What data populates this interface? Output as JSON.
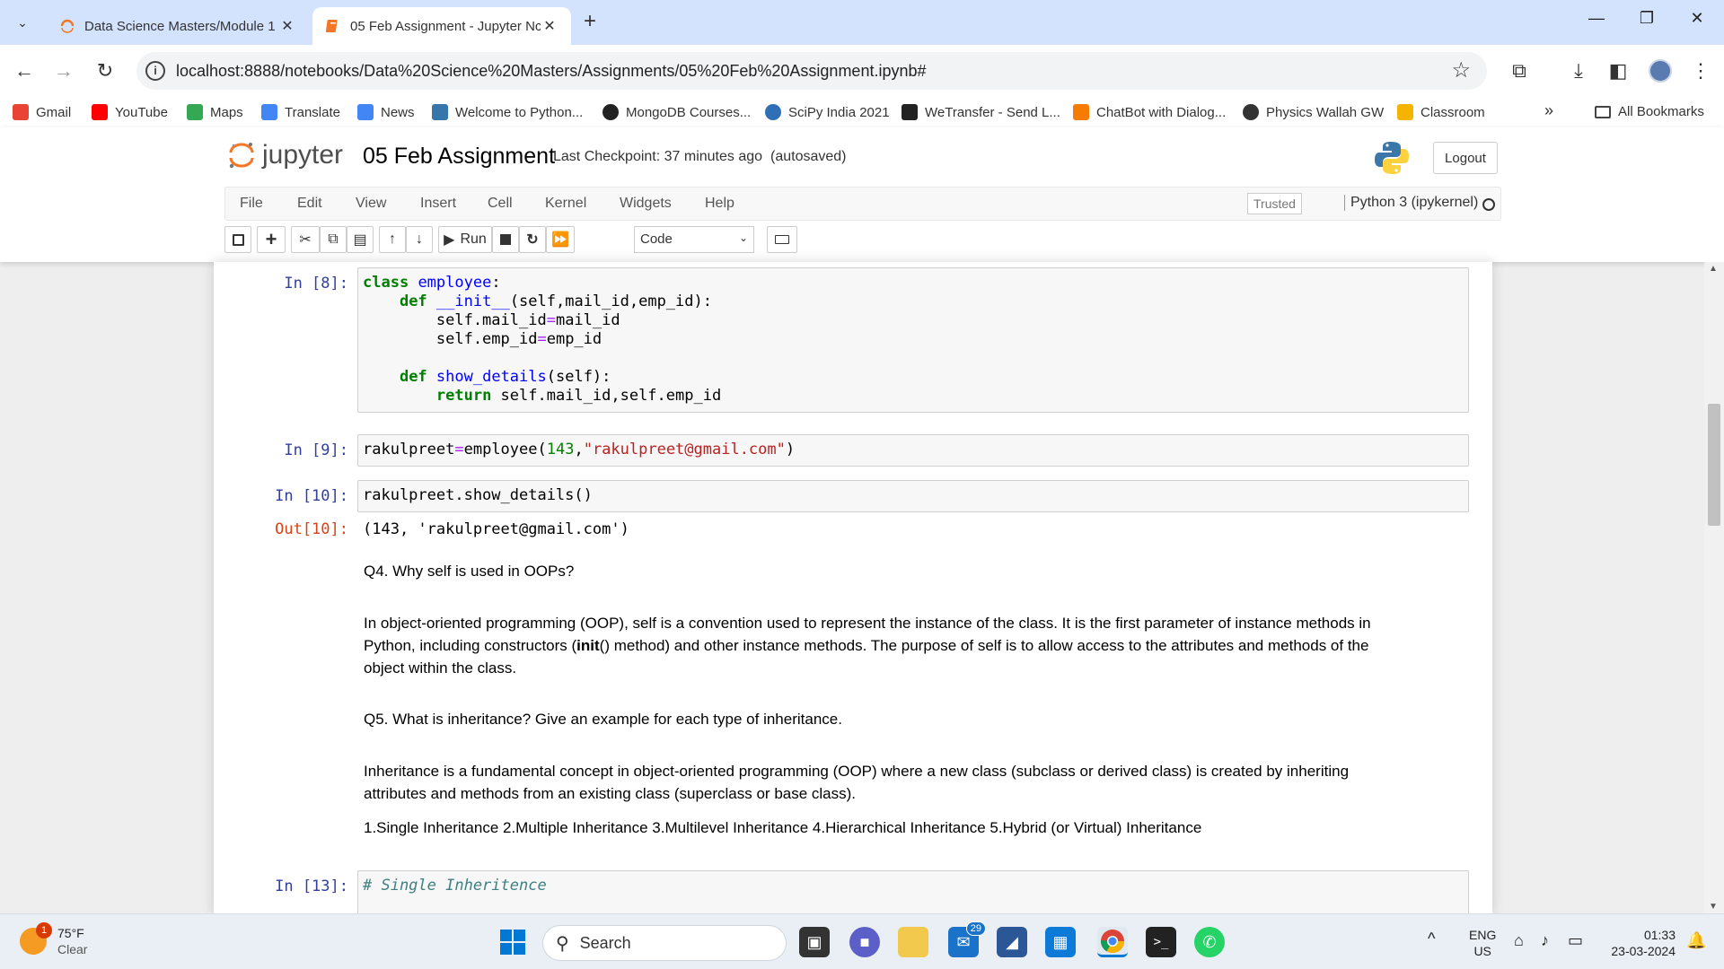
{
  "browser": {
    "tabs": [
      {
        "label": "Data Science Masters/Module 1",
        "active": false
      },
      {
        "label": "05 Feb Assignment - Jupyter Nc",
        "active": true
      }
    ],
    "new_tab": "+",
    "url": "localhost:8888/notebooks/Data%20Science%20Masters/Assignments/05%20Feb%20Assignment.ipynb#",
    "bookmarks": [
      {
        "label": "Gmail",
        "icon": "gmail-icon",
        "color": "#ea4335"
      },
      {
        "label": "YouTube",
        "icon": "youtube-icon",
        "color": "#ff0000"
      },
      {
        "label": "Maps",
        "icon": "maps-icon",
        "color": "#34a853"
      },
      {
        "label": "Translate",
        "icon": "translate-icon",
        "color": "#4285f4"
      },
      {
        "label": "News",
        "icon": "news-icon",
        "color": "#4285f4"
      },
      {
        "label": "Welcome to Python...",
        "icon": "python-icon",
        "color": "#3776ab"
      },
      {
        "label": "MongoDB Courses...",
        "icon": "mongodb-icon",
        "color": "#222222"
      },
      {
        "label": "SciPy India 2021",
        "icon": "scipy-icon",
        "color": "#2f6fb5"
      },
      {
        "label": "WeTransfer - Send L...",
        "icon": "wetransfer-icon",
        "color": "#222222"
      },
      {
        "label": "ChatBot with Dialog...",
        "icon": "chatbot-icon",
        "color": "#f57c00"
      },
      {
        "label": "Physics Wallah GW",
        "icon": "pw-icon",
        "color": "#333333"
      },
      {
        "label": "Classroom",
        "icon": "classroom-icon",
        "color": "#f4b400"
      }
    ],
    "more_bookmarks": "»",
    "all_bookmarks": "All Bookmarks"
  },
  "jupyter": {
    "logo_text": "jupyter",
    "notebook_title": "05 Feb Assignment",
    "checkpoint": "Last Checkpoint: 37 minutes ago",
    "autosaved": "(autosaved)",
    "logout": "Logout",
    "menu": [
      "File",
      "Edit",
      "View",
      "Insert",
      "Cell",
      "Kernel",
      "Widgets",
      "Help"
    ],
    "trusted": "Trusted",
    "kernel": "Python 3 (ipykernel)",
    "run_label": "Run",
    "cell_type": "Code"
  },
  "cells": {
    "c8_prompt": "In [8]:",
    "c9_prompt": "In [9]:",
    "c10_prompt": "In [10]:",
    "c10_out_prompt": "Out[10]:",
    "c10_output": "(143, 'rakulpreet@gmail.com')",
    "q4": "Q4. Why self is used in OOPs?",
    "a4_line1": "In object-oriented programming (OOP), self is a convention used to represent the instance of the class. It is the first parameter of instance methods in",
    "a4_line2a": "Python, including constructors (",
    "a4_init": "init",
    "a4_line2b": "() method) and other instance methods. The purpose of self is to allow access to the attributes and methods of the",
    "a4_line3": "object within the class.",
    "q5": "Q5. What is inheritance? Give an example for each type of inheritance.",
    "a5_line1": "Inheritance is a fundamental concept in object-oriented programming (OOP) where a new class (subclass or derived class) is created by inheriting",
    "a5_line2": "attributes and methods from an existing class (superclass or base class).",
    "a5_types": "1.Single Inheritance 2.Multiple Inheritance 3.Multilevel Inheritance 4.Hierarchical Inheritance 5.Hybrid (or Virtual) Inheritance",
    "c13_prompt": "In [13]:",
    "c13_comment": "# Single Inheritence"
  },
  "taskbar": {
    "temp": "75°F",
    "condition": "Clear",
    "weather_badge": "1",
    "search": "Search",
    "mail_badge": "29",
    "lang1": "ENG",
    "lang2": "US",
    "time": "01:33",
    "date": "23-03-2024"
  }
}
